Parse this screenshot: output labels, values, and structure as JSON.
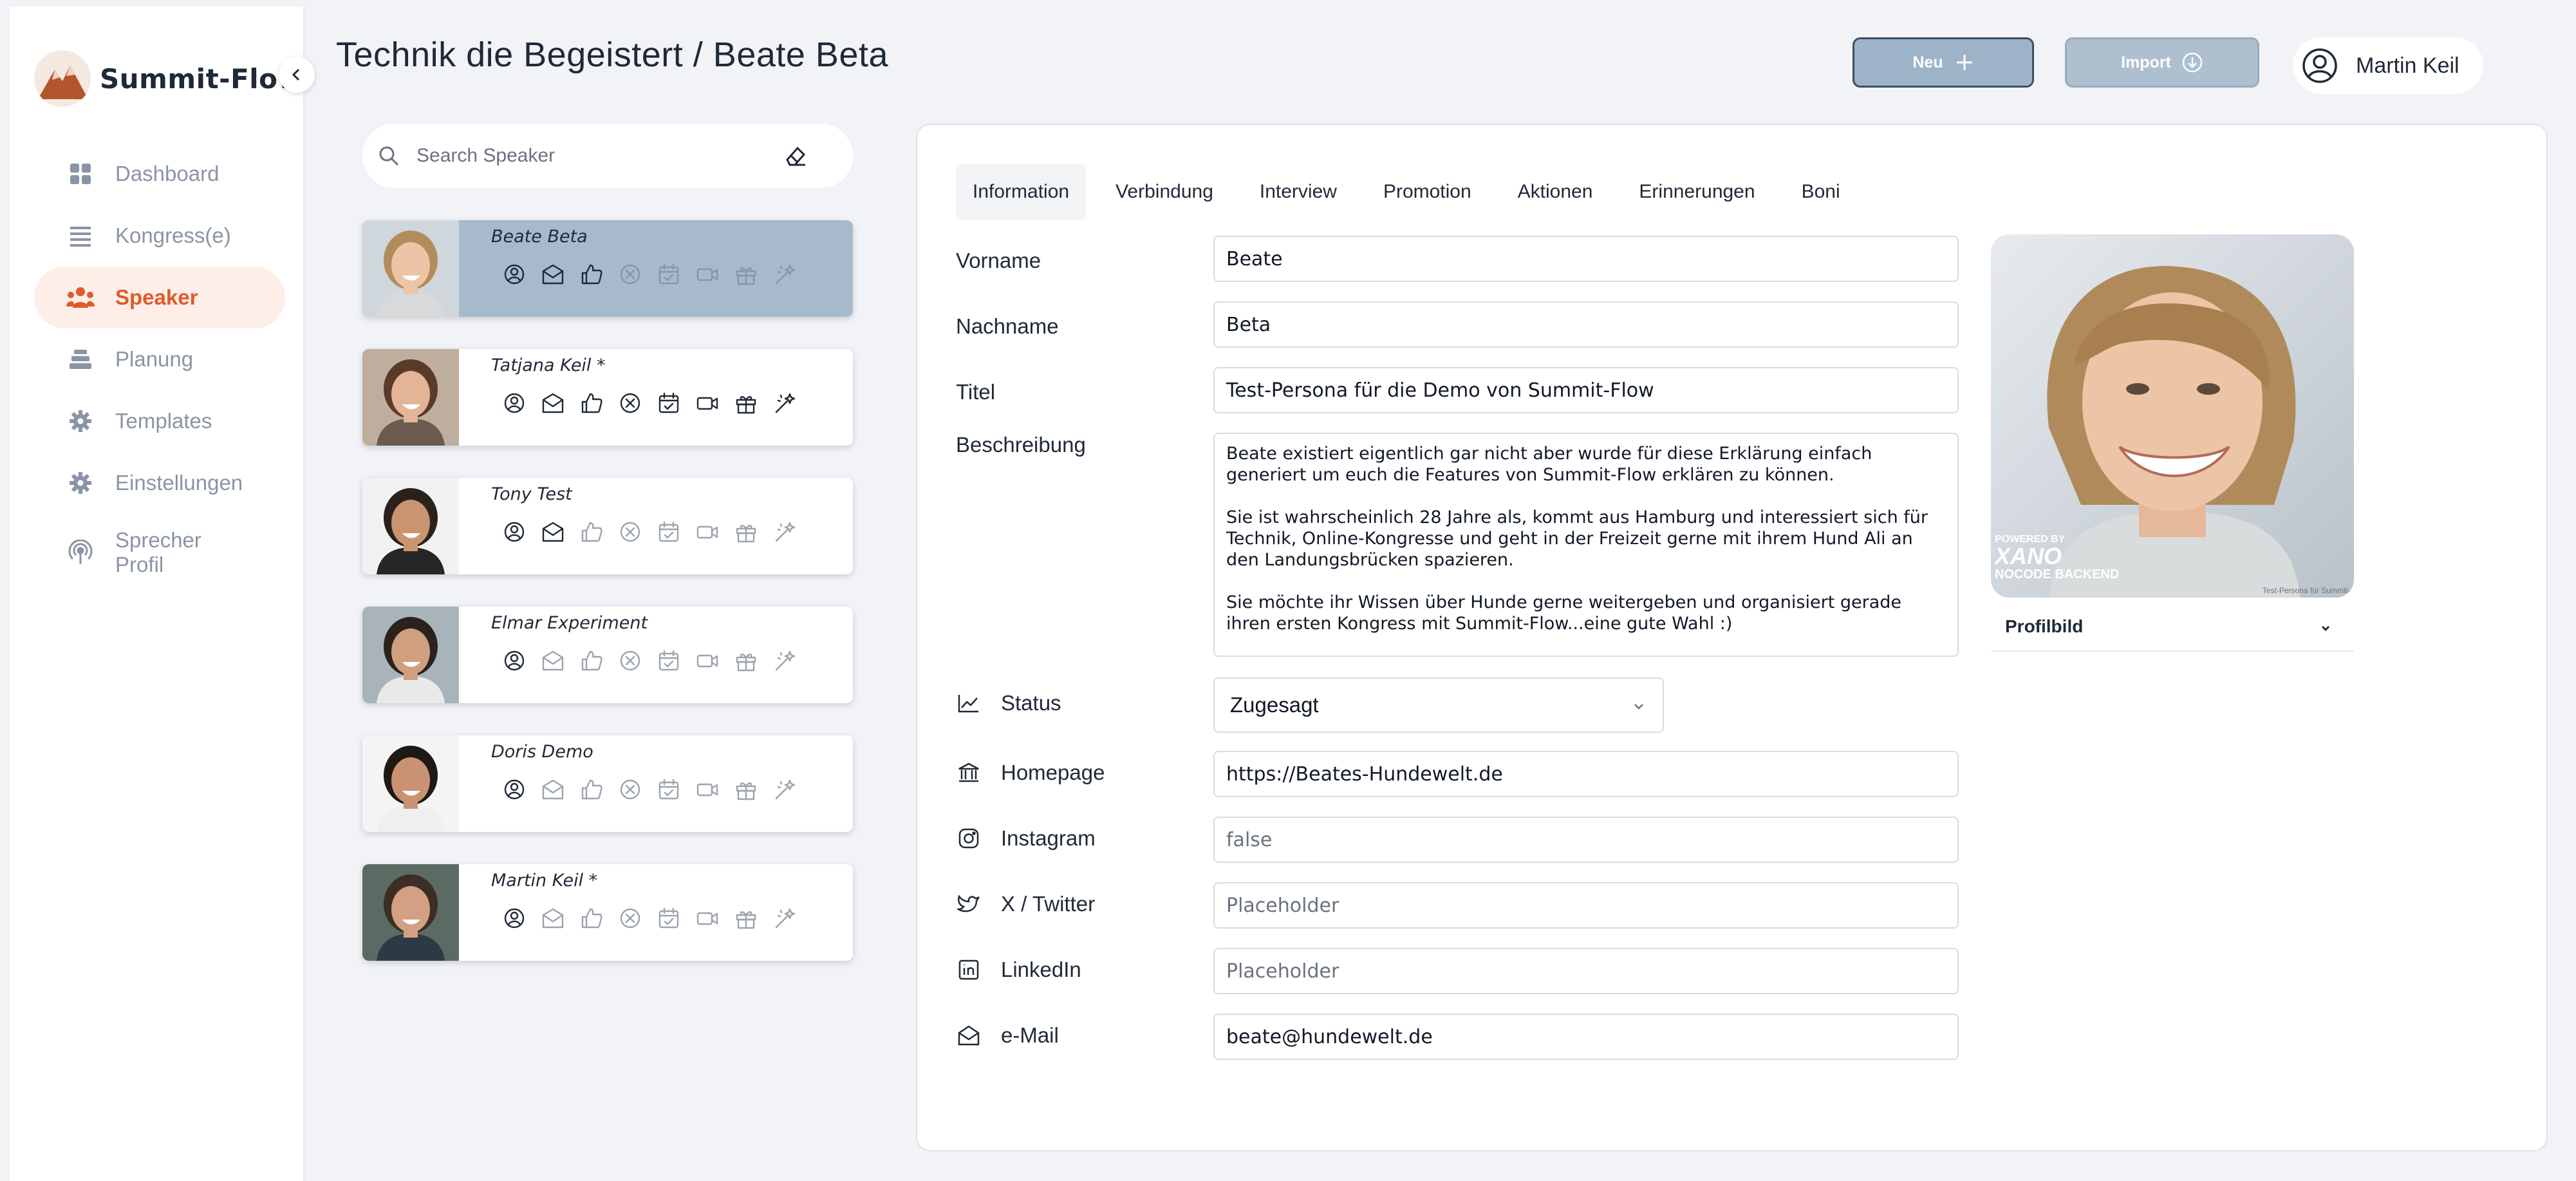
{
  "app": {
    "brand": "Summit-Flow"
  },
  "sidebar": {
    "items": [
      {
        "label": "Dashboard",
        "icon": "grid-icon",
        "active": false
      },
      {
        "label": "Kongress(e)",
        "icon": "list-icon",
        "active": false
      },
      {
        "label": "Speaker",
        "icon": "people-icon",
        "active": true
      },
      {
        "label": "Planung",
        "icon": "stack-icon",
        "active": false
      },
      {
        "label": "Templates",
        "icon": "gear-icon",
        "active": false
      },
      {
        "label": "Einstellungen",
        "icon": "gear-icon",
        "active": false
      },
      {
        "label": "Sprecher Profil",
        "icon": "podcast-icon",
        "active": false
      }
    ]
  },
  "header": {
    "title": "Technik die Begeistert / Beate Beta",
    "new_label": "Neu",
    "import_label": "Import",
    "user_name": "Martin Keil"
  },
  "search": {
    "placeholder": "Search Speaker"
  },
  "speakers": [
    {
      "name": "Beate Beta",
      "selected": true,
      "icons_active": [
        true,
        true,
        true,
        false,
        false,
        false,
        false,
        false
      ]
    },
    {
      "name": "Tatjana Keil *",
      "selected": false,
      "icons_active": [
        true,
        true,
        true,
        true,
        true,
        true,
        true,
        true
      ]
    },
    {
      "name": "Tony Test",
      "selected": false,
      "icons_active": [
        true,
        true,
        false,
        false,
        false,
        false,
        false,
        false
      ]
    },
    {
      "name": "Elmar Experiment",
      "selected": false,
      "icons_active": [
        true,
        false,
        false,
        false,
        false,
        false,
        false,
        false
      ]
    },
    {
      "name": "Doris Demo",
      "selected": false,
      "icons_active": [
        true,
        false,
        false,
        false,
        false,
        false,
        false,
        false
      ]
    },
    {
      "name": "Martin Keil *",
      "selected": false,
      "icons_active": [
        true,
        false,
        false,
        false,
        false,
        false,
        false,
        false
      ]
    }
  ],
  "tabs": [
    "Information",
    "Verbindung",
    "Interview",
    "Promotion",
    "Aktionen",
    "Erinnerungen",
    "Boni"
  ],
  "form": {
    "vorname": {
      "label": "Vorname",
      "value": "Beate"
    },
    "nachname": {
      "label": "Nachname",
      "value": "Beta"
    },
    "titel": {
      "label": "Titel",
      "value": "Test-Persona für die Demo von Summit-Flow"
    },
    "beschreibung": {
      "label": "Beschreibung",
      "paragraphs": [
        "Beate existiert eigentlich gar nicht aber wurde für diese Erklärung einfach generiert um euch die Features von Summit-Flow erklären zu können.",
        "Sie ist wahrscheinlich 28 Jahre als, kommt aus Hamburg und interessiert sich für Technik, Online-Kongresse und geht in der Freizeit gerne mit ihrem Hund Ali an den Landungsbrücken spazieren.",
        "Sie möchte ihr Wissen über Hunde gerne weitergeben und organisiert gerade ihren ersten Kongress mit Summit-Flow...eine gute Wahl :)"
      ]
    },
    "status": {
      "label": "Status",
      "value": "Zugesagt"
    },
    "homepage": {
      "label": "Homepage",
      "value": "https://Beates-Hundewelt.de"
    },
    "instagram": {
      "label": "Instagram",
      "value": "false"
    },
    "twitter": {
      "label": "X / Twitter",
      "placeholder": "Placeholder"
    },
    "linkedin": {
      "label": "LinkedIn",
      "placeholder": "Placeholder"
    },
    "email": {
      "label": "e-Mail",
      "value": "beate@hundewelt.de"
    }
  },
  "profile": {
    "label": "Profilbild",
    "watermark_lines": [
      "POWERED BY",
      "XANO",
      "NOCODE BACKEND"
    ],
    "caption": "Test-Persona für Summit-"
  },
  "colors": {
    "accent": "#e05a2b",
    "selected_card": "#a6bacc",
    "button": "#9db3c8"
  }
}
